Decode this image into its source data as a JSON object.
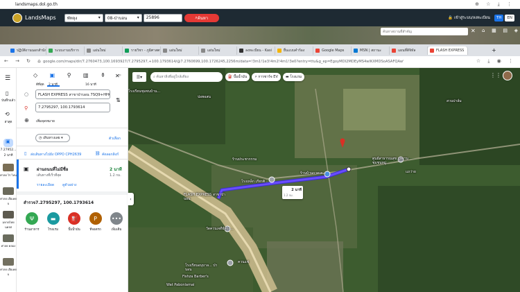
{
  "browser_top": {
    "url": "landsmaps.dol.go.th"
  },
  "landsmaps": {
    "logo": "LandsMaps",
    "province": "พัทลุง",
    "district": "08-ป่าบอน",
    "parcel": "25896",
    "search_btn": "ค้นหา",
    "guest": "เข้าสู่ระบบ/ลงทะเบียน",
    "lang_th": "TH",
    "lang_en": "EN",
    "place_search_placeholder": "ค้นหาสถานที่สำคัญ"
  },
  "tabs": [
    {
      "label": "ปฏิบัติงานนอกสำนัก",
      "color": "#1a73e8"
    },
    {
      "label": "ระบบงานบริการ",
      "color": "#34a853"
    },
    {
      "label": "แผ่นใหม่",
      "color": "#888888"
    },
    {
      "label": "รายวิชา - ภูมิศาสตร์",
      "color": "#0f9d58"
    },
    {
      "label": "แผ่นใหม่",
      "color": "#888888"
    },
    {
      "label": "แผ่นใหม่",
      "color": "#888888"
    },
    {
      "label": "ลงทะเบียน - Kasi",
      "color": "#333333"
    },
    {
      "label": "ยื่นแบบคำร้อง",
      "color": "#f4b400"
    },
    {
      "label": "Google Maps",
      "color": "#ea4335"
    },
    {
      "label": "MSN | สถานะ",
      "color": "#0078d4"
    },
    {
      "label": "แผนที่ดิจิทัล",
      "color": "#ea4335"
    },
    {
      "label": "FLASH EXPRESS",
      "color": "#ea4335"
    }
  ],
  "address": {
    "url": "google.com/maps/dir/7.2760473,100.1693927/7.2795297,+100.1793614/@7.2760699,100.1726245,2256m/data=!3m1!1e3!4m2!4m1!3e0?entry=ttu&g_ep=EgoyMDI2MDEyMS4wIKXMDSoASAFQAw%3D%3D"
  },
  "rail": {
    "saved": "บันทึกแล้ว",
    "history": "ล่าสุด",
    "recent1_title": "7.27952...",
    "recent1_sub": "2 นาที",
    "recent2": "ศาลย ไร่ ไหน",
    "recent3": "ศาลย เสือเคยบ",
    "recent4": "มหาดไทย นครศ",
    "recent5": "ศาลย คลอง",
    "recent6": "ศาลย เสือเคยบ"
  },
  "modes": {
    "best": "ดีที่สุด",
    "car": "2 นาที",
    "walk": "16 นาที"
  },
  "route": {
    "origin": "FLASH EXPRESS สาขาป่าบอน 7SQ9+HHC",
    "destination": "7.2795297, 100.1793614",
    "add_stop": "เพิ่มจุดหมาย",
    "depart": "เดินทางเลย",
    "options": "ตัวเลือก",
    "send_phone": "ส่งเส้นทางไปยัง OPPO CPH2639",
    "copy_link": "คัดลอกลิงก์",
    "via": "ผ่านถนนที่ไม่มีชื่อ",
    "via_sub": "เส้นทางที่เร็วที่สุด",
    "duration": "2 นาที",
    "distance": "1.2 กม.",
    "details": "รายละเอียด",
    "preview": "ดูตัวอย่าง"
  },
  "nearby": {
    "title": "สำรวจ7.2795297, 100.1793614",
    "items": [
      {
        "label": "ร้านอาหาร",
        "color": "#34a853",
        "icon": "utensils-icon"
      },
      {
        "label": "โรงแรม",
        "color": "#1a9aa0",
        "icon": "bed-icon"
      },
      {
        "label": "ปั๊มน้ำมัน",
        "color": "#d93025",
        "icon": "fuel-icon"
      },
      {
        "label": "ที่จอดรถ",
        "color": "#b06000",
        "icon": "parking-icon"
      },
      {
        "label": "เพิ่มเติม",
        "color": "#80868b",
        "icon": "more-icon"
      }
    ]
  },
  "map": {
    "search_placeholder": "ค้นหาสิ่งที่อยู่ใกล้เคียง",
    "chip_gas": "ปั๊มน้ำมัน",
    "chip_ev": "การชาร์จ EV",
    "chip_hotel": "โรงแรม",
    "label_school": "โรงเรียนชุมชนบ้าน...",
    "label_pakbon": "ปอพอสน",
    "label_suan": "สวนปาล์ม",
    "label_market": "ร้านประชากรรม",
    "label_flash": "FLASH EXPRESS สาขาป่าบอน",
    "label_temple": "วัดควนเจดีย์พระ...",
    "label_shop": "ร้านบ้านกาดเค...",
    "label_center": "ศูนย์สาธารณสุข มูลฐานชุมชนหมู่...",
    "label_row": "แถว่าย",
    "label_wat": "Wat Pabonlamai",
    "label_barber": "Fishza Barber's",
    "label_school2": "โรงเรียนอนุบาล... ป่าบอน",
    "label_phan": "โรงเหล็ก เกียรติ...",
    "label_koch": "ควนแช่",
    "route_time": "2 นาที",
    "route_dist": "1.2 กม."
  }
}
